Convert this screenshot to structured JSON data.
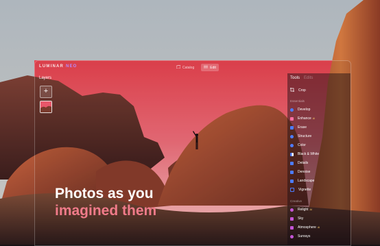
{
  "app": {
    "logo_main": "LUMINAR",
    "logo_ai": "NEO",
    "modes": [
      {
        "label": "Catalog",
        "active": false
      },
      {
        "label": "Edit",
        "active": true
      }
    ]
  },
  "layers": {
    "title": "Layers",
    "add_label": "+"
  },
  "tools": {
    "tabs": [
      {
        "label": "Tools",
        "active": true
      },
      {
        "label": "Edits",
        "active": false
      }
    ],
    "crop_label": "Crop",
    "essentials_label": "Essentials",
    "essentials": [
      {
        "label": "Develop",
        "color": "#4d7cff",
        "badge": ""
      },
      {
        "label": "Enhance",
        "color": "#ff6fa3",
        "badge": "AI"
      },
      {
        "label": "Erase",
        "color": "#4d7cff",
        "badge": ""
      },
      {
        "label": "Structure",
        "color": "#4d7cff",
        "badge": ""
      },
      {
        "label": "Color",
        "color": "#4d7cff",
        "badge": ""
      },
      {
        "label": "Black & White",
        "color": "#4d7cff",
        "badge": ""
      },
      {
        "label": "Details",
        "color": "#4d7cff",
        "badge": ""
      },
      {
        "label": "Denoise",
        "color": "#4d7cff",
        "badge": ""
      },
      {
        "label": "Landscape",
        "color": "#4d7cff",
        "badge": ""
      },
      {
        "label": "Vignette",
        "color": "#4d7cff",
        "badge": ""
      }
    ],
    "creative_label": "Creative",
    "creative": [
      {
        "label": "Relight",
        "color": "#c455d6",
        "badge": "AI"
      },
      {
        "label": "Sky",
        "color": "#c455d6",
        "badge": ""
      },
      {
        "label": "Atmosphere",
        "color": "#c455d6",
        "badge": "AI"
      },
      {
        "label": "Sunrays",
        "color": "#c455d6",
        "badge": ""
      }
    ]
  },
  "headline": {
    "line1": "Photos as you",
    "line2": "imagined them"
  },
  "colors": {
    "accent_pink": "#f07b8a",
    "tool_blue": "#4d7cff"
  }
}
